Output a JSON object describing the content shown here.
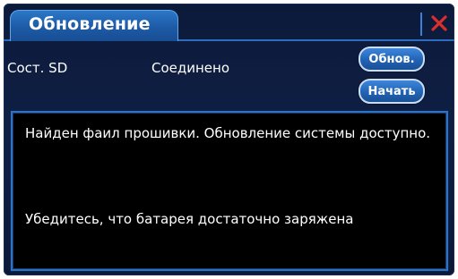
{
  "window": {
    "tab_title": "Обновление",
    "close_symbol": "✕"
  },
  "status": {
    "label": "Сост. SD",
    "value": "Соединено"
  },
  "buttons": {
    "refresh_label": "Обнов.",
    "start_label": "Начать"
  },
  "messages": {
    "line1": "Найден фаил прошивки. Обновление системы доступно.",
    "line2": "Убедитесь, что батарея достаточно заряжена"
  },
  "colors": {
    "accent": "#2b78c8",
    "close": "#d9302b"
  }
}
